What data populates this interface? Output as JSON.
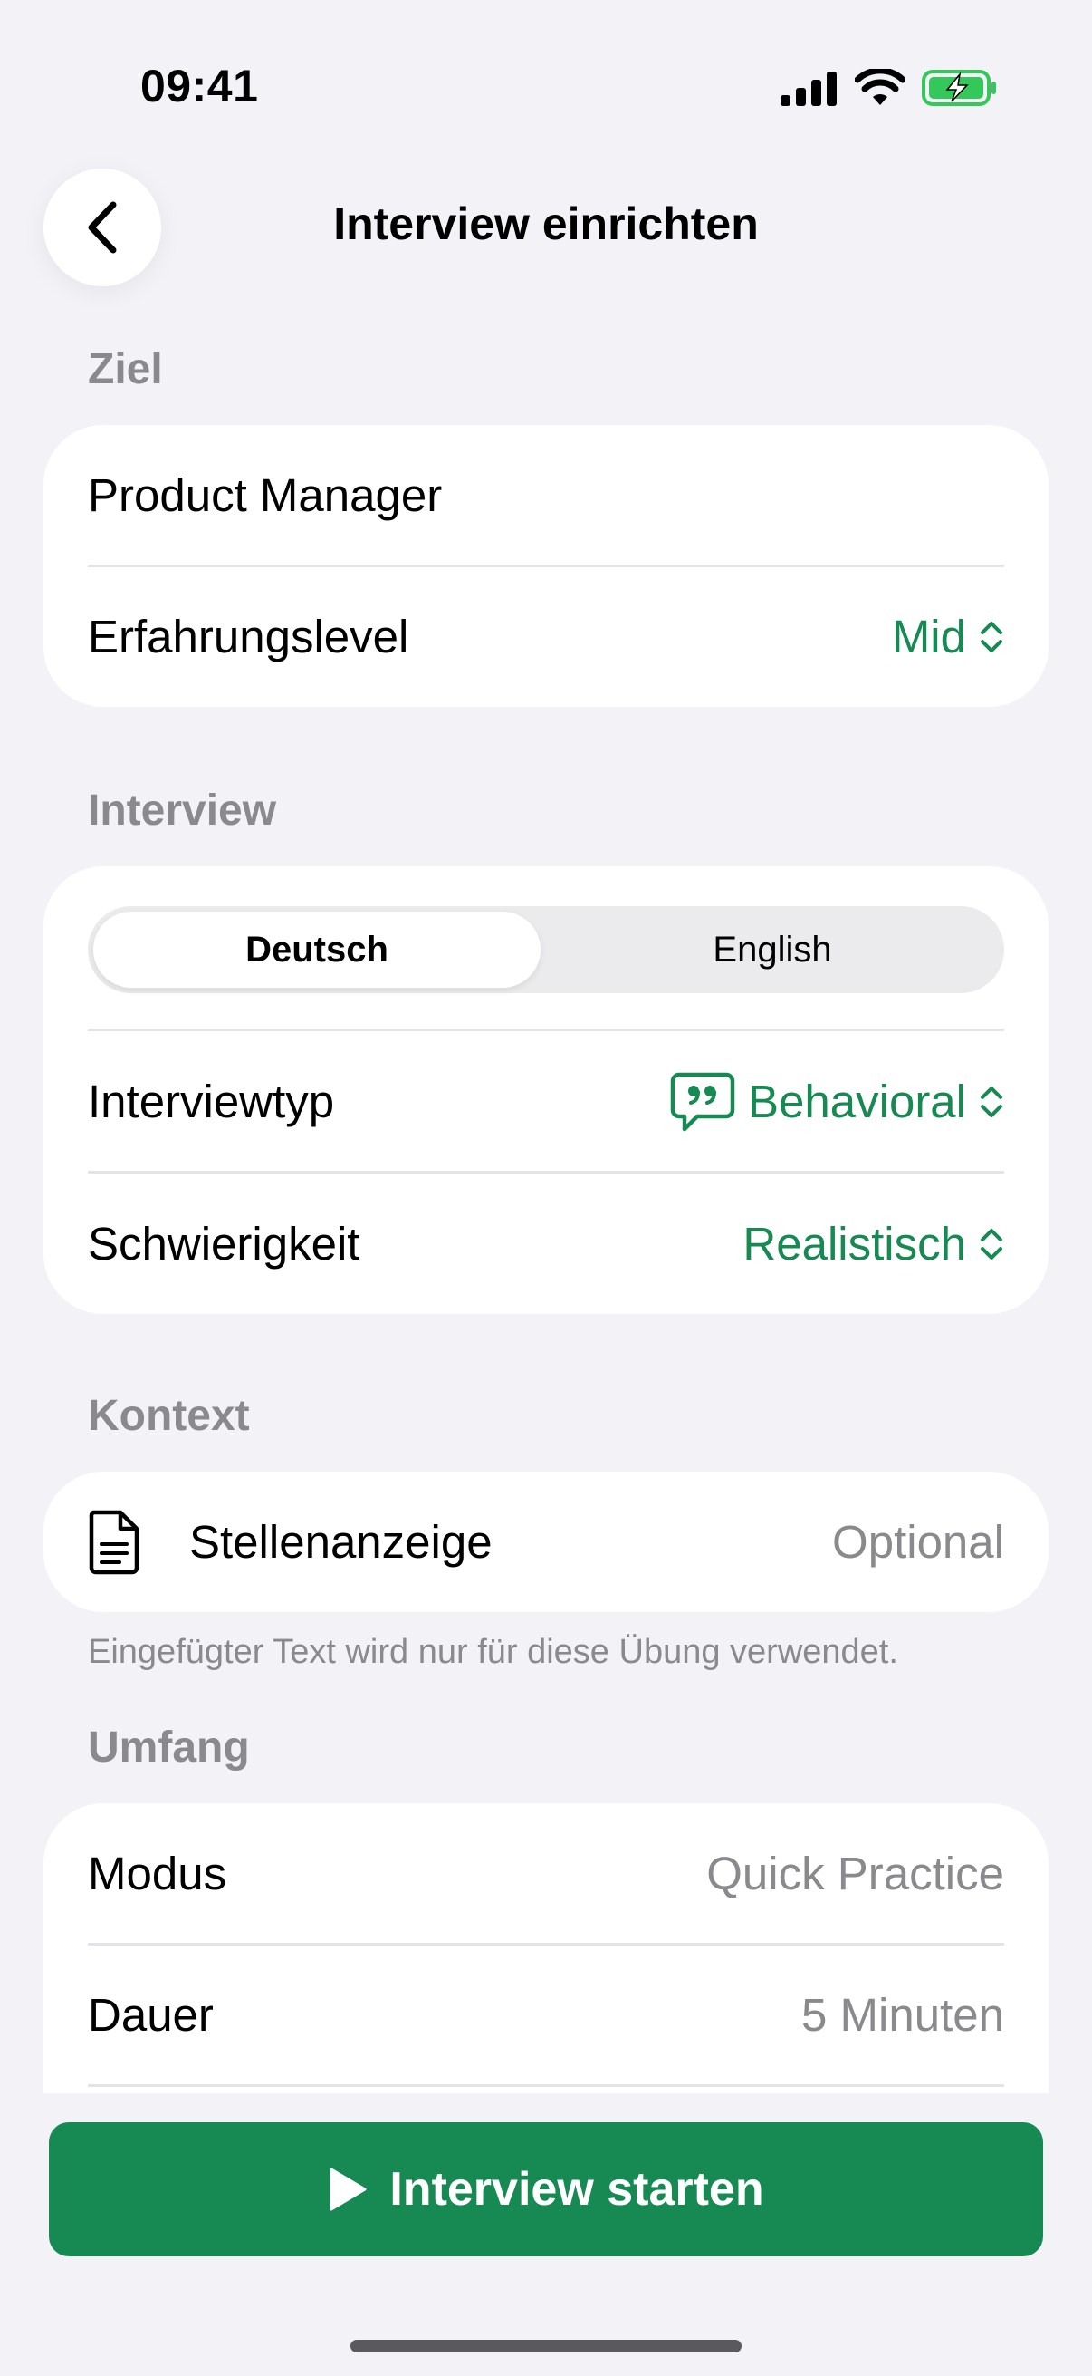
{
  "status_bar": {
    "time": "09:41",
    "icons": [
      "cellular-signal-icon",
      "wifi-icon",
      "battery-charging-icon"
    ]
  },
  "nav": {
    "back_icon": "chevron-left-icon",
    "title": "Interview einrichten"
  },
  "sections": {
    "goal": {
      "header": "Ziel",
      "role": "Product Manager",
      "experience_label": "Erfahrungslevel",
      "experience_value": "Mid"
    },
    "interview": {
      "header": "Interview",
      "language_options": [
        "Deutsch",
        "English"
      ],
      "language_selected": "Deutsch",
      "type_label": "Interviewtyp",
      "type_icon": "speech-bubble-quote-icon",
      "type_value": "Behavioral",
      "difficulty_label": "Schwierigkeit",
      "difficulty_value": "Realistisch"
    },
    "context": {
      "header": "Kontext",
      "job_posting_icon": "document-icon",
      "job_posting_label": "Stellenanzeige",
      "job_posting_value": "Optional",
      "footnote": "Eingefügter Text wird nur für diese Übung verwendet."
    },
    "scope": {
      "header": "Umfang",
      "mode_label": "Modus",
      "mode_value": "Quick Practice",
      "duration_label": "Dauer",
      "duration_value": "5 Minuten"
    }
  },
  "actions": {
    "start_icon": "play-icon",
    "start_label": "Interview starten"
  },
  "colors": {
    "accent": "#168A52",
    "background": "#F2F2F7",
    "secondary_text": "#8A8A8E",
    "battery": "#34C759"
  }
}
